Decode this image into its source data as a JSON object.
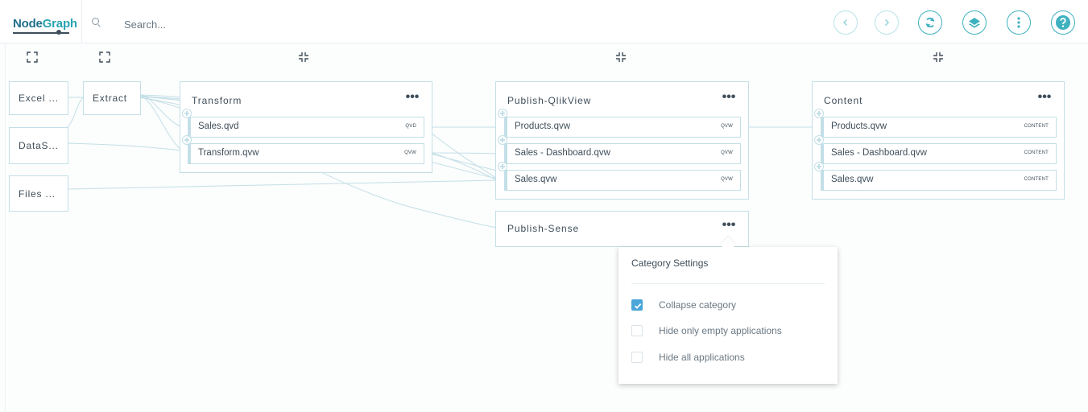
{
  "brand": {
    "part1": "Node",
    "part2": "Graph"
  },
  "search": {
    "placeholder": "Search..."
  },
  "toolbar": {
    "buttons": [
      {
        "name": "back-button",
        "icon": "chevron-left-icon"
      },
      {
        "name": "forward-button",
        "icon": "chevron-right-icon"
      },
      {
        "name": "sync-button",
        "icon": "refresh-icon"
      },
      {
        "name": "layers-button",
        "icon": "layers-icon"
      },
      {
        "name": "more-button",
        "icon": "more-vertical-icon"
      },
      {
        "name": "help-button",
        "icon": "help-icon"
      }
    ]
  },
  "sources": [
    {
      "label": "Excel ..."
    },
    {
      "label": "DataS..."
    },
    {
      "label": "Files ..."
    }
  ],
  "extract": {
    "label": "Extract"
  },
  "categories": {
    "transform": {
      "title": "Transform",
      "apps": [
        {
          "name": "Sales.qvd",
          "tag": "QVD"
        },
        {
          "name": "Transform.qvw",
          "tag": "QVW"
        }
      ]
    },
    "publish_qlikview": {
      "title": "Publish-QlikView",
      "apps": [
        {
          "name": "Products.qvw",
          "tag": "QVW"
        },
        {
          "name": "Sales - Dashboard.qvw",
          "tag": "QVW"
        },
        {
          "name": "Sales.qvw",
          "tag": "QVW"
        }
      ]
    },
    "publish_sense": {
      "title": "Publish-Sense"
    },
    "content": {
      "title": "Content",
      "apps": [
        {
          "name": "Products.qvw",
          "tag": "CONTENT"
        },
        {
          "name": "Sales - Dashboard.qvw",
          "tag": "CONTENT"
        },
        {
          "name": "Sales.qvw",
          "tag": "CONTENT"
        }
      ]
    }
  },
  "more_glyph": "•••",
  "settings_popup": {
    "title": "Category Settings",
    "options": [
      {
        "label": "Collapse category",
        "checked": true
      },
      {
        "label": "Hide only empty applications",
        "checked": false
      },
      {
        "label": "Hide all applications",
        "checked": false
      }
    ]
  },
  "colors": {
    "accent": "#3eb1bf",
    "border": "#c3dfe7",
    "check": "#4aa6d9",
    "text": "#3f4e5a"
  }
}
